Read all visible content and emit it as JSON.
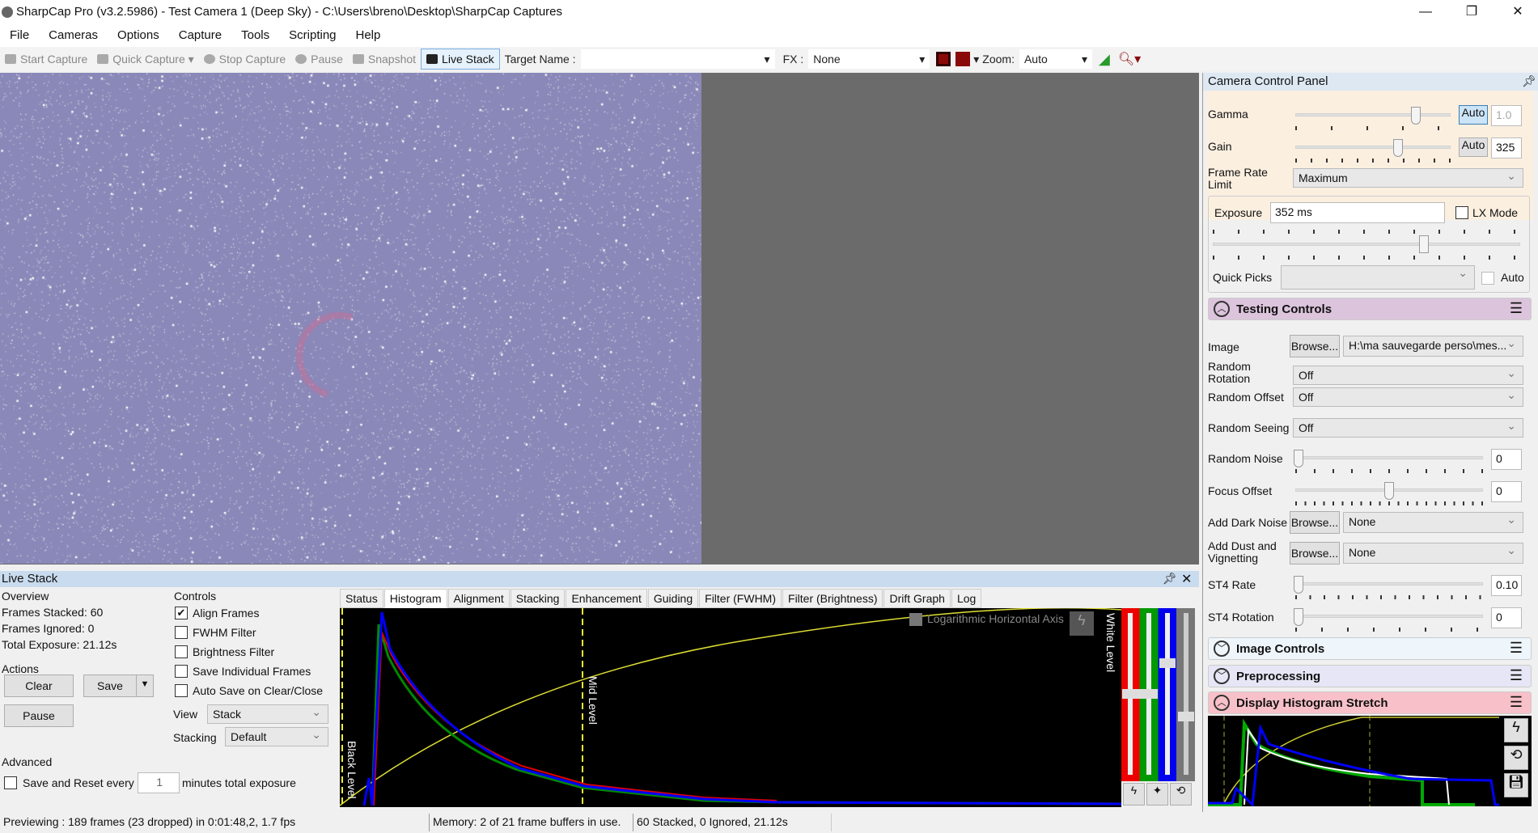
{
  "window": {
    "title": "SharpCap Pro (v3.2.5986) - Test Camera 1 (Deep Sky) - C:\\Users\\breno\\Desktop\\SharpCap Captures",
    "minimize": "—",
    "maximize": "❐",
    "close": "✕"
  },
  "menu": [
    "File",
    "Cameras",
    "Options",
    "Capture",
    "Tools",
    "Scripting",
    "Help"
  ],
  "toolbar": {
    "start_capture": "Start Capture",
    "quick_capture": "Quick Capture",
    "stop_capture": "Stop Capture",
    "pause": "Pause",
    "snapshot": "Snapshot",
    "live_stack": "Live Stack",
    "target_name_label": "Target Name :",
    "target_name_value": "",
    "fx_label": "FX :",
    "fx_value": "None",
    "zoom_label": "Zoom:",
    "zoom_value": "Auto"
  },
  "camera_panel": {
    "title": "Camera Control Panel",
    "gamma": {
      "label": "Gamma",
      "auto": "Auto",
      "value": "1.0",
      "slider": 0.77
    },
    "gain": {
      "label": "Gain",
      "auto": "Auto",
      "value": "325",
      "slider": 0.65
    },
    "frame_rate": {
      "label": "Frame Rate Limit",
      "value": "Maximum"
    },
    "exposure": {
      "label": "Exposure",
      "value": "352 ms",
      "lx_mode": "LX Mode",
      "slider": 0.69
    },
    "quick_picks": {
      "label": "Quick Picks",
      "value": "",
      "auto": "Auto"
    },
    "testing": {
      "title": "Testing Controls",
      "image": {
        "label": "Image",
        "browse": "Browse...",
        "value": "H:\\ma sauvegarde perso\\mes..."
      },
      "random_rotation": {
        "label": "Random Rotation",
        "value": "Off"
      },
      "random_offset": {
        "label": "Random Offset",
        "value": "Off"
      },
      "random_seeing": {
        "label": "Random Seeing",
        "value": "Off"
      },
      "random_noise": {
        "label": "Random Noise",
        "value": "0"
      },
      "focus_offset": {
        "label": "Focus Offset",
        "value": "0"
      },
      "dark_noise": {
        "label": "Add Dark Noise",
        "browse": "Browse...",
        "value": "None"
      },
      "dust": {
        "label": "Add Dust and Vignetting",
        "browse": "Browse...",
        "value": "None"
      },
      "st4_rate": {
        "label": "ST4 Rate",
        "value": "0.10"
      },
      "st4_rotation": {
        "label": "ST4 Rotation",
        "value": "0"
      }
    },
    "image_controls": "Image Controls",
    "preprocessing": "Preprocessing",
    "display_stretch": "Display Histogram Stretch"
  },
  "live_stack": {
    "title": "Live Stack",
    "overview": "Overview",
    "frames_stacked": "Frames Stacked: 60",
    "frames_ignored": "Frames Ignored:  0",
    "total_exposure": "Total Exposure:   21.12s",
    "actions": "Actions",
    "clear": "Clear",
    "save": "Save",
    "pause": "Pause",
    "advanced": "Advanced",
    "save_reset": "Save and Reset every",
    "minutes": "1",
    "minutes_suffix": "minutes total exposure",
    "controls": "Controls",
    "checks": [
      {
        "label": "Align Frames",
        "checked": true
      },
      {
        "label": "FWHM Filter",
        "checked": false
      },
      {
        "label": "Brightness Filter",
        "checked": false
      },
      {
        "label": "Save Individual Frames",
        "checked": false
      },
      {
        "label": "Auto Save on Clear/Close",
        "checked": false
      }
    ],
    "view_label": "View",
    "view_value": "Stack",
    "stacking_label": "Stacking",
    "stacking_value": "Default",
    "tabs": [
      "Status",
      "Histogram",
      "Alignment",
      "Stacking",
      "Enhancement",
      "Guiding",
      "Filter (FWHM)",
      "Filter (Brightness)",
      "Drift Graph",
      "Log"
    ],
    "active_tab": "Histogram",
    "histogram": {
      "log_axis": "Logarithmic Horizontal Axis",
      "black_level": "Black Level",
      "mid_level": "Mid Level",
      "white_level": "White Level"
    }
  },
  "status": {
    "preview": "Previewing : 189 frames (23 dropped) in 0:01:48,2, 1.7 fps",
    "memory": "Memory: 2 of 21 frame buffers in use.",
    "stack": "60 Stacked, 0 Ignored, 21.12s"
  }
}
